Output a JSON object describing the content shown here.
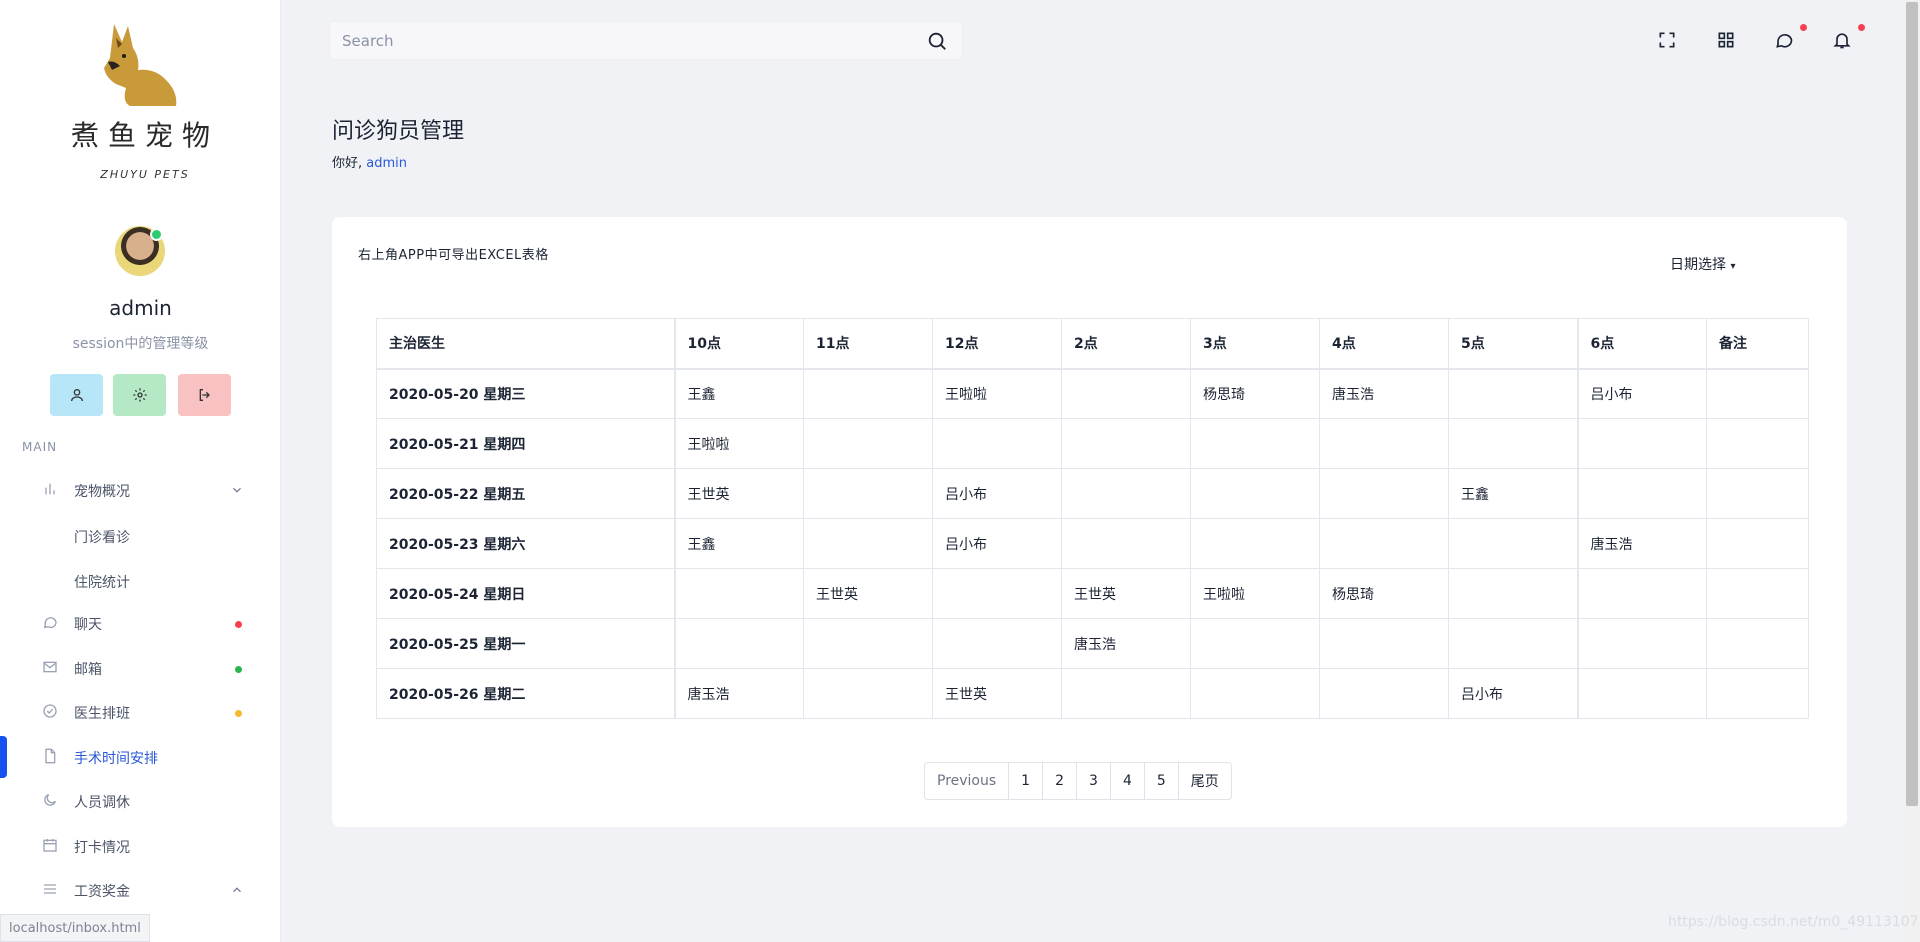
{
  "brand": {
    "title": "煮鱼宠物",
    "subtitle": "ZHUYU PETS"
  },
  "user": {
    "name": "admin",
    "role": "session中的管理等级"
  },
  "sidebar": {
    "section_label": "MAIN",
    "items": [
      {
        "label": "宠物概况",
        "icon": "bar-chart-icon"
      },
      {
        "label": "门诊看诊"
      },
      {
        "label": "住院统计"
      },
      {
        "label": "聊天",
        "icon": "chat-icon",
        "dot_color": "#f5414f"
      },
      {
        "label": "邮箱",
        "icon": "mail-icon",
        "dot_color": "#28b54c"
      },
      {
        "label": "医生排班",
        "icon": "check-circle-icon",
        "dot_color": "#f5b82e"
      },
      {
        "label": "手术时间安排",
        "icon": "file-icon"
      },
      {
        "label": "人员调休",
        "icon": "moon-icon"
      },
      {
        "label": "打卡情况",
        "icon": "calendar-icon"
      },
      {
        "label": "工资奖金",
        "icon": "menu-lines-icon"
      }
    ]
  },
  "status_url": "localhost/inbox.html",
  "search": {
    "placeholder": "Search"
  },
  "page": {
    "title": "问诊狗员管理",
    "greeting_prefix": "你好,",
    "greeting_user": "admin"
  },
  "card": {
    "note": "右上角APP中可导出EXCEL表格",
    "date_select": "日期选择"
  },
  "table": {
    "headers": [
      "主治医生",
      "10点",
      "11点",
      "12点",
      "2点",
      "3点",
      "4点",
      "5点",
      "6点",
      "备注"
    ],
    "rows": [
      [
        "2020-05-20 星期三",
        "王鑫",
        "",
        "王啦啦",
        "",
        "杨思琦",
        "唐玉浩",
        "",
        "吕小布",
        ""
      ],
      [
        "2020-05-21 星期四",
        "王啦啦",
        "",
        "",
        "",
        "",
        "",
        "",
        "",
        ""
      ],
      [
        "2020-05-22 星期五",
        "王世英",
        "",
        "吕小布",
        "",
        "",
        "",
        "王鑫",
        "",
        ""
      ],
      [
        "2020-05-23 星期六",
        "王鑫",
        "",
        "吕小布",
        "",
        "",
        "",
        "",
        "唐玉浩",
        ""
      ],
      [
        "2020-05-24 星期日",
        "",
        "王世英",
        "",
        "王世英",
        "王啦啦",
        "杨思琦",
        "",
        "",
        ""
      ],
      [
        "2020-05-25 星期一",
        "",
        "",
        "",
        "唐玉浩",
        "",
        "",
        "",
        "",
        ""
      ],
      [
        "2020-05-26 星期二",
        "唐玉浩",
        "",
        "王世英",
        "",
        "",
        "",
        "吕小布",
        "",
        ""
      ]
    ]
  },
  "pagination": {
    "previous": "Previous",
    "pages": [
      "1",
      "2",
      "3",
      "4",
      "5"
    ],
    "last": "尾页"
  },
  "watermark": "https://blog.csdn.net/m0_49113107"
}
